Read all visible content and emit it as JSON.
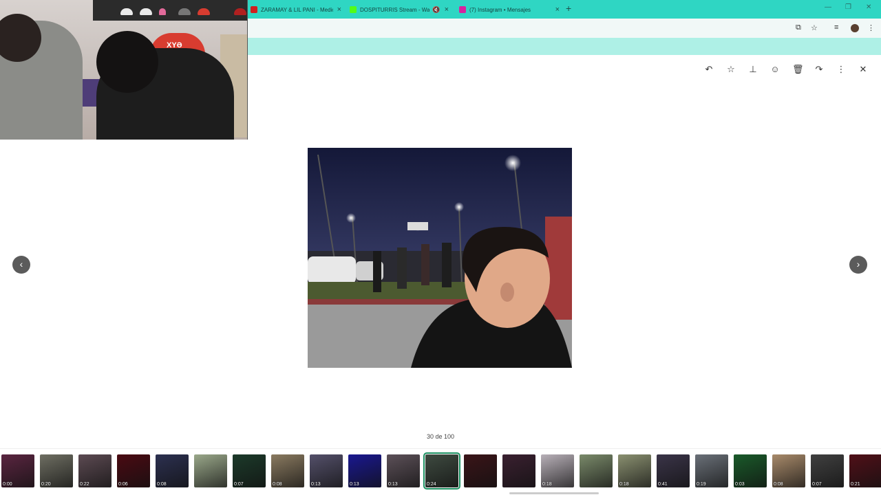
{
  "browser": {
    "tabs": [
      {
        "title": "ZARAMAY & LIL PANI - Medio",
        "favicon_color": "#d02020"
      },
      {
        "title": "DOSPITURRIS Stream - Wat",
        "favicon_color": "#53fc18",
        "muted": true,
        "mute_glyph": "🔇"
      },
      {
        "title": "(7) Instagram • Mensajes",
        "favicon_color": "#d6249f"
      }
    ],
    "close_glyph": "×",
    "new_tab_glyph": "+",
    "window_controls": {
      "minimize": "—",
      "restore": "❐",
      "close": "✕"
    },
    "toolbar_icons": {
      "cast": "⧉",
      "bookmark": "☆",
      "media": "≡",
      "menu": "⋮"
    }
  },
  "webcam": {
    "helmet_text": "XYƏ"
  },
  "viewer": {
    "actions": [
      {
        "name": "reply-icon",
        "glyph": "↶"
      },
      {
        "name": "star-icon",
        "glyph": "☆"
      },
      {
        "name": "pin-icon",
        "glyph": "⊥"
      },
      {
        "name": "emoji-icon",
        "glyph": "☺"
      },
      {
        "name": "trash-icon",
        "glyph": "🗑"
      },
      {
        "name": "forward-icon",
        "glyph": "↷"
      },
      {
        "name": "more-icon",
        "glyph": "⋮"
      },
      {
        "name": "close-icon",
        "glyph": "✕"
      }
    ],
    "prev_glyph": "‹",
    "next_glyph": "›",
    "counter": "30 de 100"
  },
  "thumbnails": [
    {
      "duration": "0:00",
      "color": "#5a2540"
    },
    {
      "duration": "0:20",
      "color": "#6e6e62"
    },
    {
      "duration": "0:22",
      "color": "#5c4a52"
    },
    {
      "duration": "0:06",
      "color": "#4a0a12"
    },
    {
      "duration": "0:08",
      "color": "#2c3050"
    },
    {
      "duration": "",
      "color": "#9aa88a"
    },
    {
      "duration": "0:07",
      "color": "#1c3a2a"
    },
    {
      "duration": "0:08",
      "color": "#8a7a60"
    },
    {
      "duration": "0:13",
      "color": "#54506a"
    },
    {
      "duration": "0:13",
      "color": "#1a1890"
    },
    {
      "duration": "0:13",
      "color": "#5c5058"
    },
    {
      "duration": "0:24",
      "color": "#3e4a40",
      "selected": true
    },
    {
      "duration": "",
      "color": "#3a1418"
    },
    {
      "duration": "",
      "color": "#3a2030"
    },
    {
      "duration": "0:18",
      "color": "#b8b0b8"
    },
    {
      "duration": "",
      "color": "#7a8a6a"
    },
    {
      "duration": "0:18",
      "color": "#8a9070"
    },
    {
      "duration": "0:41",
      "color": "#3a3448"
    },
    {
      "duration": "0:19",
      "color": "#6a7078"
    },
    {
      "duration": "0:03",
      "color": "#1a5a2a"
    },
    {
      "duration": "0:08",
      "color": "#a88a6a"
    },
    {
      "duration": "0:07",
      "color": "#404040"
    },
    {
      "duration": "0:21",
      "color": "#501018"
    }
  ]
}
